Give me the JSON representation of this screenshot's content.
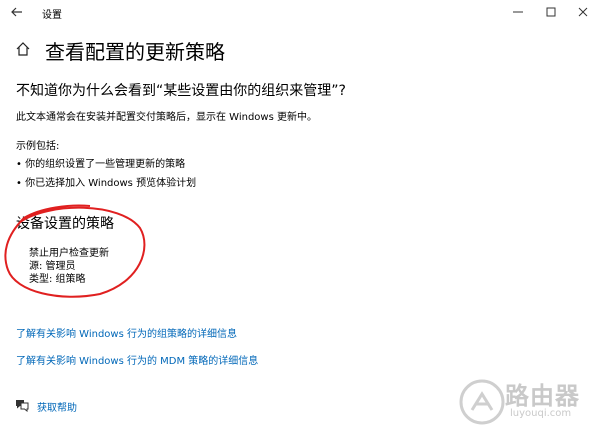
{
  "window": {
    "title": "设置",
    "back_icon": "arrow-left-icon",
    "controls": [
      "minimize-icon",
      "maximize-icon",
      "close-icon"
    ]
  },
  "page": {
    "home_icon": "home-icon",
    "title": "查看配置的更新策略"
  },
  "intro": {
    "question": "不知道你为什么会看到“某些设置由你的组织来管理”?",
    "description": "此文本通常会在安装并配置交付策略后，显示在 Windows 更新中。",
    "examples_label": "示例包括:",
    "bullets": [
      "• 你的组织设置了一些管理更新的策略",
      "• 你已选择加入 Windows 预览体验计划"
    ]
  },
  "policies": {
    "section_title": "设备设置的策略",
    "items": [
      "禁止用户检查更新",
      "源: 管理员",
      "类型: 组策略"
    ]
  },
  "links": [
    "了解有关影响 Windows 行为的组策略的详细信息",
    "了解有关影响 Windows 行为的 MDM 策略的详细信息"
  ],
  "help": {
    "icon": "chat-help-icon",
    "label": "获取帮助"
  },
  "annotation": {
    "color": "#e02020"
  },
  "watermark": {
    "name": "路由器",
    "url": "luyouqi.com"
  },
  "colors": {
    "link": "#0067b8",
    "background": "#ffffff"
  }
}
